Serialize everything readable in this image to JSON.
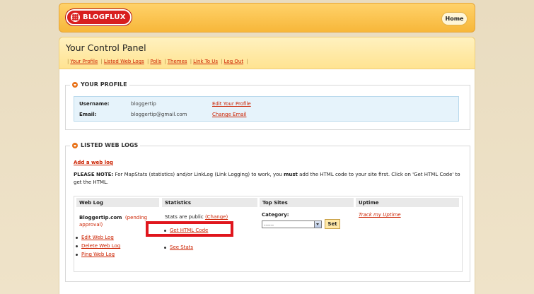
{
  "header": {
    "logo_text": "BLOGFLUX",
    "home_label": "Home"
  },
  "title": "Your Control Panel",
  "nav": [
    "Your Profile",
    "Listed Web Logs",
    "Polls",
    "Themes",
    "Link To Us",
    "Log Out"
  ],
  "profile": {
    "heading": "YOUR PROFILE",
    "rows": [
      {
        "label": "Username:",
        "value": "bloggertip",
        "action": "Edit Your Profile"
      },
      {
        "label": "Email:",
        "value": "bloggertip@gmail.com",
        "action": "Change Email"
      }
    ]
  },
  "weblogs": {
    "heading": "LISTED WEB LOGS",
    "add_link": "Add a web log",
    "note_label": "PLEASE NOTE:",
    "note_text_1": "For MapStats (statistics) and/or LinkLog (Link Logging) to work, you",
    "note_must": "must",
    "note_text_2": "add the HTML code to your site first. Click on 'Get HTML Code' to get the HTML.",
    "columns": [
      "Web Log",
      "Statistics",
      "Top Sites",
      "Uptime"
    ],
    "blog_name": "Bloggertip.com",
    "blog_status": "(pending approval)",
    "blog_actions": [
      "Edit Web Log",
      "Delete Web Log",
      "Ping Web Log"
    ],
    "stats_label": "Stats are public",
    "stats_change": "(Change)",
    "stats_actions": [
      "Get HTML Code",
      "See Stats"
    ],
    "topsites_label": "Category:",
    "topsites_select": "------",
    "topsites_button": "Set",
    "uptime_link": "Track my Uptime"
  },
  "colors": {
    "accent": "#cc2200",
    "header": "#f7b73a",
    "highlight": "#e0161d"
  }
}
